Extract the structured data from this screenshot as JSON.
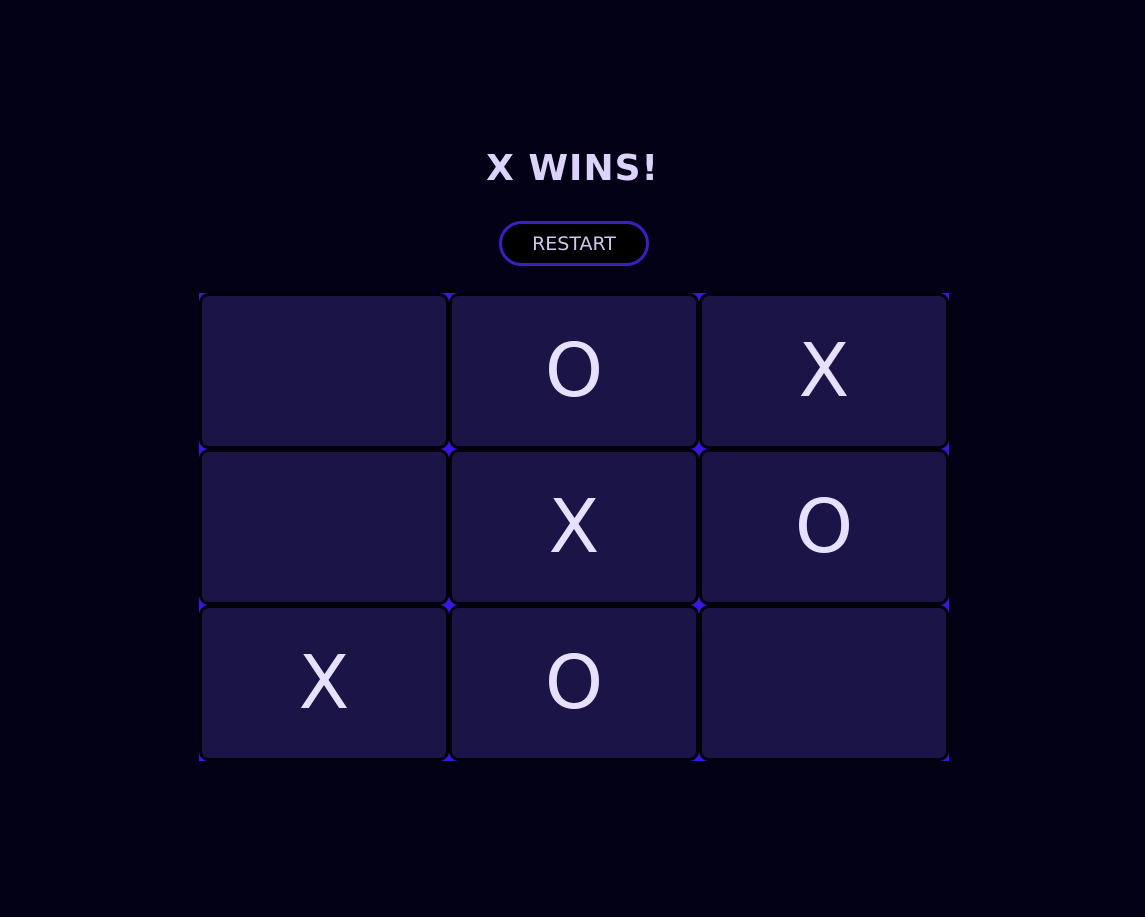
{
  "game": {
    "status": "X WINS!",
    "restart_label": "RESTART",
    "cells": [
      "",
      "O",
      "X",
      "",
      "X",
      "O",
      "X",
      "O",
      ""
    ]
  }
}
